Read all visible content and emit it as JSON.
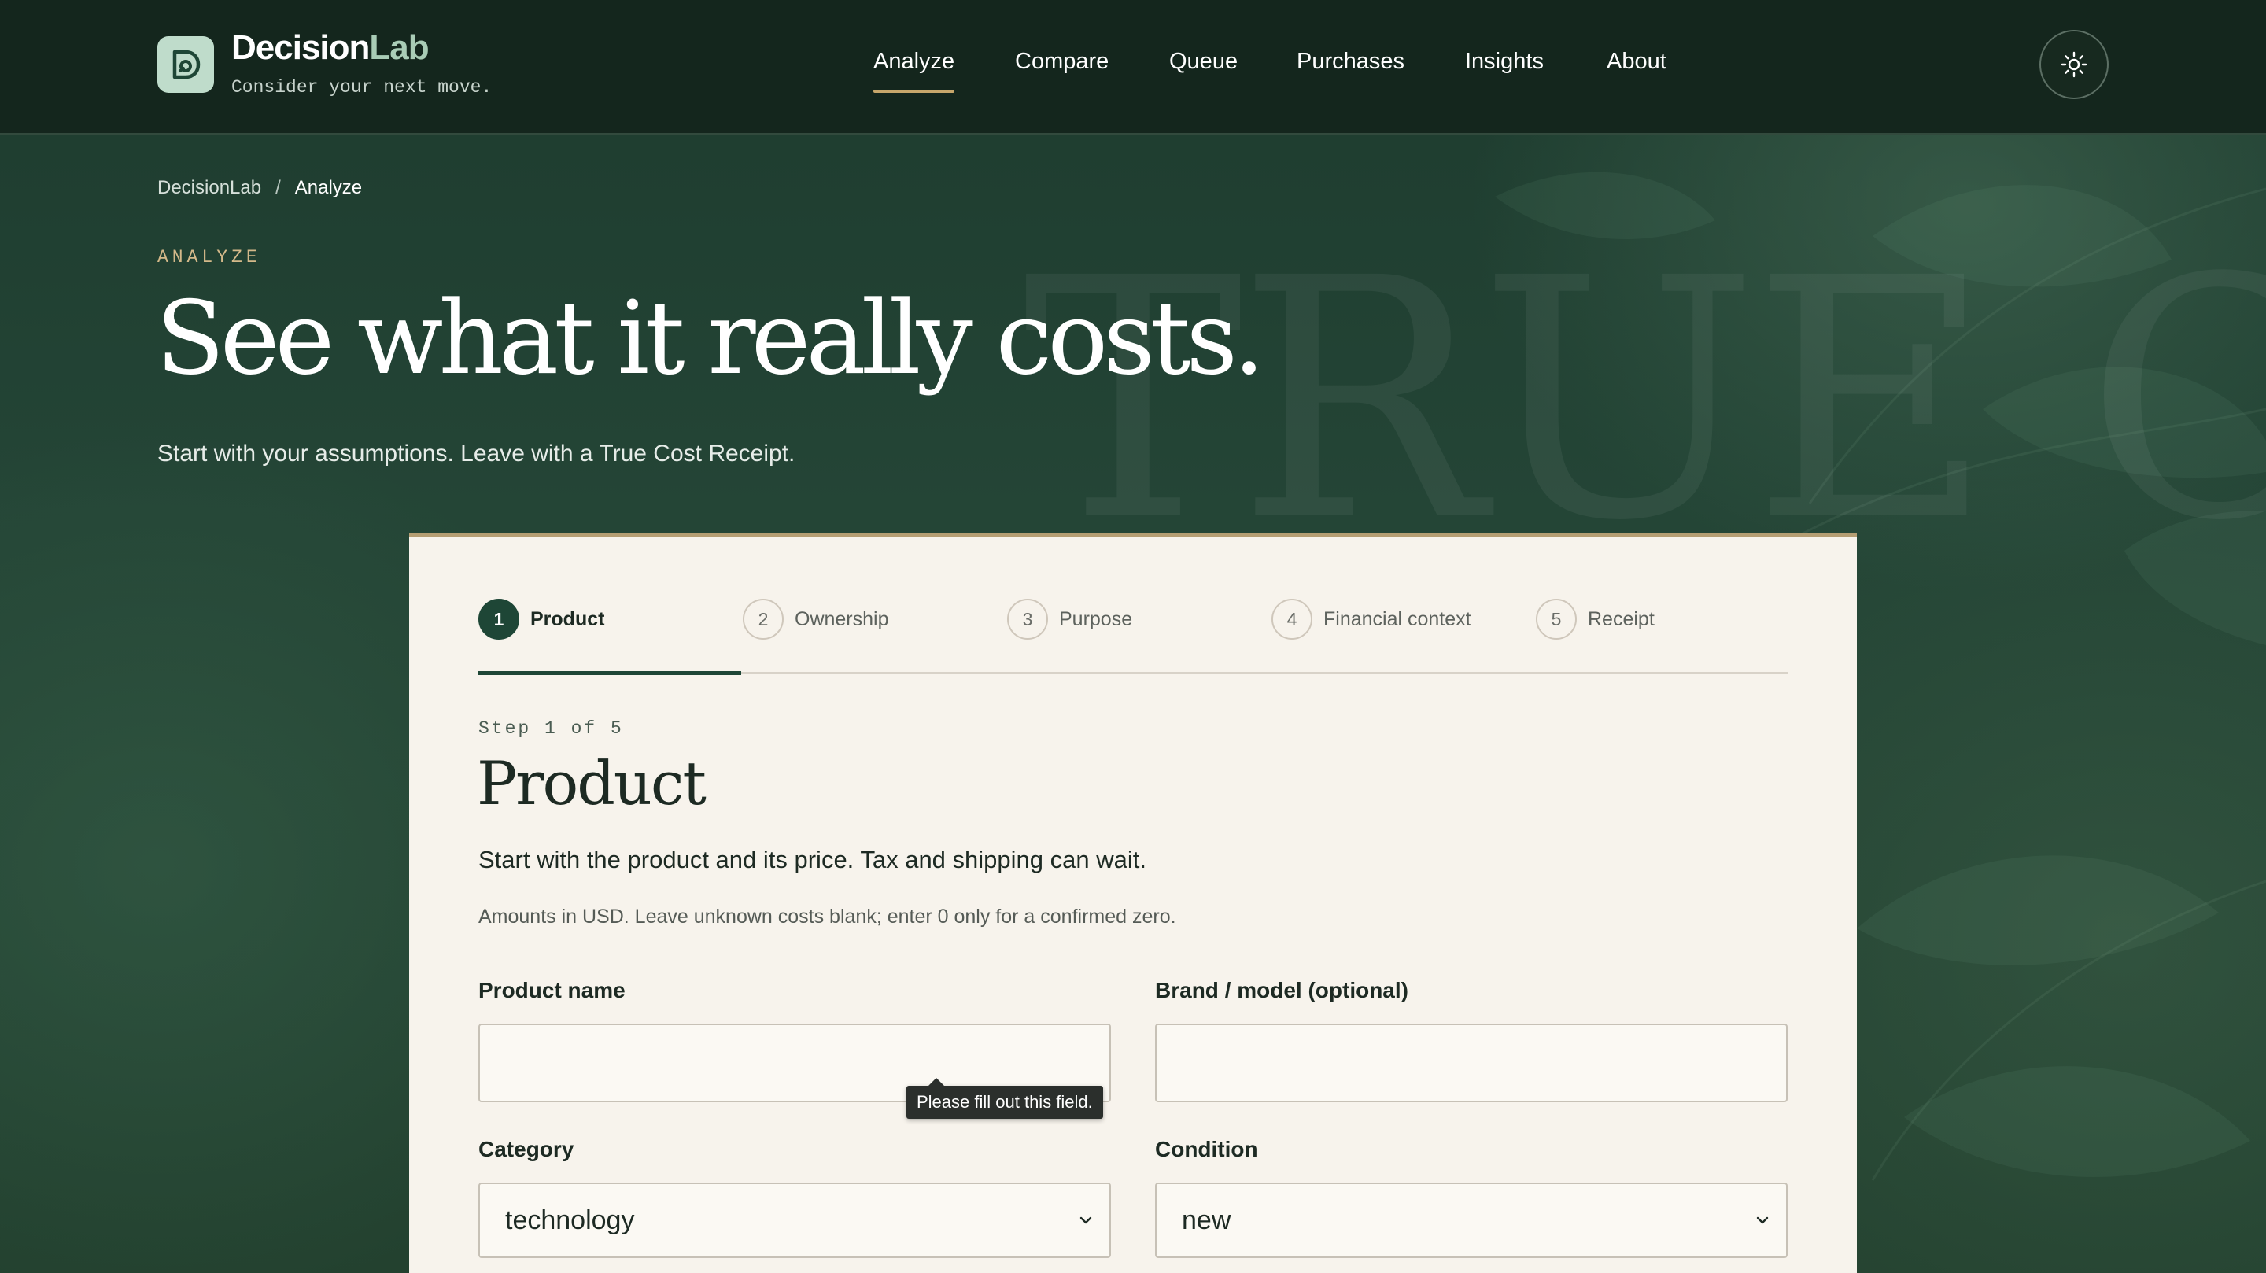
{
  "app": {
    "brand_primary": "Decision",
    "brand_accent": "Lab",
    "tagline": "Consider your next move.",
    "logo_icon": "decisionlab-logo-icon"
  },
  "nav": {
    "items": [
      {
        "label": "Analyze",
        "active": true
      },
      {
        "label": "Compare",
        "active": false
      },
      {
        "label": "Queue",
        "active": false
      },
      {
        "label": "Purchases",
        "active": false
      },
      {
        "label": "Insights",
        "active": false
      },
      {
        "label": "About",
        "active": false
      }
    ],
    "theme_toggle_icon": "sun-icon"
  },
  "breadcrumb": {
    "root": "DecisionLab",
    "separator": "/",
    "current": "Analyze"
  },
  "hero": {
    "eyebrow": "ANALYZE",
    "title": "See what it really costs.",
    "subtitle": "Start with your assumptions. Leave with a True Cost Receipt.",
    "watermark": "TRUE CO"
  },
  "wizard": {
    "steps": [
      {
        "num": "1",
        "label": "Product",
        "active": true
      },
      {
        "num": "2",
        "label": "Ownership",
        "active": false
      },
      {
        "num": "3",
        "label": "Purpose",
        "active": false
      },
      {
        "num": "4",
        "label": "Financial context",
        "active": false
      },
      {
        "num": "5",
        "label": "Receipt",
        "active": false
      }
    ],
    "step_count": "Step 1 of 5",
    "title": "Product",
    "lead": "Start with the product and its price. Tax and shipping can wait.",
    "note": "Amounts in USD. Leave unknown costs blank; enter 0 only for a confirmed zero."
  },
  "form": {
    "product_name": {
      "label": "Product name",
      "value": "",
      "placeholder": ""
    },
    "brand_model": {
      "label": "Brand / model (optional)",
      "value": "",
      "placeholder": ""
    },
    "category": {
      "label": "Category",
      "value": "technology"
    },
    "condition": {
      "label": "Condition",
      "value": "new"
    },
    "validation_tooltip": "Please fill out this field."
  },
  "colors": {
    "header_bg": "#14261d",
    "accent_gold": "#c7a66b",
    "primary_green": "#1e4636",
    "card_bg": "#f7f3ec"
  }
}
